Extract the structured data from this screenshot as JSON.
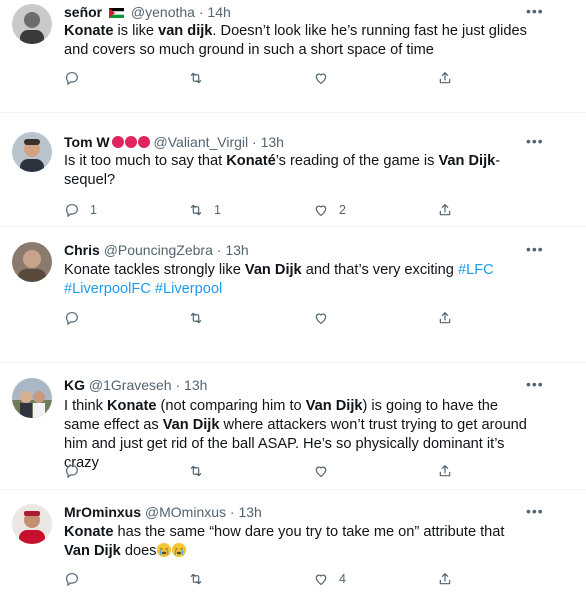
{
  "tweets": [
    {
      "name": "señor",
      "handle": "@yenotha",
      "time": "14h",
      "segments": [
        {
          "t": "Konate",
          "b": true
        },
        {
          "t": " is like ",
          "b": false
        },
        {
          "t": "van dijk",
          "b": true
        },
        {
          "t": ". Doesn’t look like he’s running fast he just glides and covers so much ground in such a short space of time",
          "b": false
        }
      ],
      "reply_count": "",
      "retweet_count": "",
      "like_count": ""
    },
    {
      "name": "Tom W",
      "handle": "@Valiant_Virgil",
      "time": "13h",
      "segments": [
        {
          "t": "Is it too much to say that ",
          "b": false
        },
        {
          "t": "Konaté",
          "b": true
        },
        {
          "t": "’s reading of the game is ",
          "b": false
        },
        {
          "t": "Van Dijk",
          "b": true
        },
        {
          "t": "-sequel?",
          "b": false
        }
      ],
      "reply_count": "1",
      "retweet_count": "1",
      "like_count": "2"
    },
    {
      "name": "Chris",
      "handle": "@PouncingZebra",
      "time": "13h",
      "segments": [
        {
          "t": "Konate tackles strongly like ",
          "b": false
        },
        {
          "t": "Van Dijk",
          "b": true
        },
        {
          "t": " and that’s very exciting ",
          "b": false
        },
        {
          "t": "#LFC",
          "b": false,
          "h": true
        },
        {
          "t": " ",
          "b": false
        },
        {
          "t": "#LiverpoolFC",
          "b": false,
          "h": true
        },
        {
          "t": " ",
          "b": false
        },
        {
          "t": "#Liverpool",
          "b": false,
          "h": true
        }
      ],
      "reply_count": "",
      "retweet_count": "",
      "like_count": ""
    },
    {
      "name": "KG",
      "handle": "@1Graveseh",
      "time": "13h",
      "segments": [
        {
          "t": "I think ",
          "b": false
        },
        {
          "t": "Konate",
          "b": true
        },
        {
          "t": " (not comparing him to ",
          "b": false
        },
        {
          "t": "Van Dijk",
          "b": true
        },
        {
          "t": ") is going to have the same effect as ",
          "b": false
        },
        {
          "t": "Van Dijk",
          "b": true
        },
        {
          "t": " where attackers won’t trust trying to get around him and just get rid of the ball ASAP. He’s so physically dominant it’s crazy",
          "b": false
        }
      ],
      "reply_count": "",
      "retweet_count": "",
      "like_count": ""
    },
    {
      "name": "MrOminxus",
      "handle": "@MOminxus",
      "time": "13h",
      "segments": [
        {
          "t": "Konate",
          "b": true
        },
        {
          "t": " has the same “how dare you try to take me on” attribute that ",
          "b": false
        },
        {
          "t": "Van Dijk",
          "b": true
        },
        {
          "t": " does",
          "b": false
        }
      ],
      "reply_count": "",
      "retweet_count": "",
      "like_count": "4"
    }
  ],
  "icons": {
    "reply": "reply-icon",
    "retweet": "retweet-icon",
    "like": "heart-icon",
    "share": "share-icon",
    "more": "more-icon"
  },
  "colors": {
    "hashtag": "#1d9bf0",
    "secondary": "#536471",
    "divider": "#eff3f4",
    "heart_red": "#e0245e"
  }
}
